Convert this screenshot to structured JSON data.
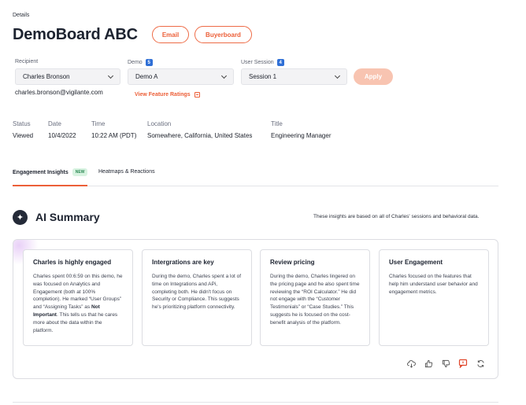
{
  "breadcrumb": "Details",
  "header": {
    "title": "DemoBoard ABC",
    "email_label": "Email",
    "buyerboard_label": "Buyerboard"
  },
  "filters": {
    "recipient_label": "Recipient",
    "recipient_value": "Charles Bronson",
    "demo_label": "Demo",
    "demo_count": "5",
    "demo_value": "Demo A",
    "session_label": "User Session",
    "session_count": "4",
    "session_value": "Session 1",
    "apply_label": "Apply",
    "email": "charles.bronson@vigilante.com",
    "view_ratings": "View Feature Ratings"
  },
  "meta": {
    "status_label": "Status",
    "status_value": "Viewed",
    "date_label": "Date",
    "date_value": "10/4/2022",
    "time_label": "Time",
    "time_value": "10:22 AM (PDT)",
    "location_label": "Location",
    "location_value": "Somewhere, California, United States",
    "title_label": "Title",
    "title_value": "Engineering Manager"
  },
  "tabs": {
    "engagement": "Engagement Insights",
    "new_badge": "NEW",
    "heatmaps": "Heatmaps & Reactions"
  },
  "ai": {
    "title": "AI Summary",
    "note": "These insights are based on all of Charles' sessions and behavioral data.",
    "cards": [
      {
        "title": "Charles is highly engaged",
        "text_a": "Charles spent 00:6:59 on this demo, he was focused on Analytics and Engagement (both at 100% completion). He marked “User Groups” and “Assigning Tasks” as ",
        "text_bold": "Not Important",
        "text_b": ". This tells us that he cares more about the data within the platform."
      },
      {
        "title": "Intergrations are key",
        "text": "During the demo, Charles spent a lot of time on Integrations and APi, completing both. He didn't focus on Security or Compliance. This suggests he's prioritizing platform connectivity."
      },
      {
        "title": "Review pricing",
        "text": "During the demo, Charles lingered on the pricing page and he also spent time reviewing the “ROI Calculator.” He did not engage with the “Customer Testimonials” or “Case Studies.” This suggests he is focused on the cost-benefit analysis of the platform."
      },
      {
        "title": "User Engagement",
        "text": "Charles focused on the features that help him understand user behavior and engagement metrics."
      }
    ]
  },
  "icons": [
    "sparkle-icon",
    "cloud-download-icon",
    "thumbs-up-icon",
    "thumbs-down-icon",
    "flag-icon",
    "refresh-icon",
    "chevron-down-icon",
    "list-icon"
  ],
  "colors": {
    "accent": "#ec5f38",
    "badge_blue": "#2f6fd6",
    "dark": "#1d2330"
  }
}
